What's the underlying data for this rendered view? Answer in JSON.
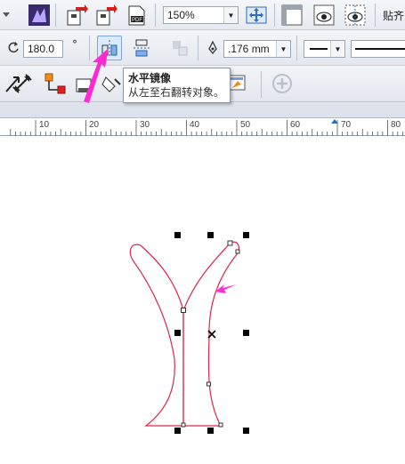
{
  "toolbar_top": {
    "zoom_value": "150%",
    "snap_label": "贴齐"
  },
  "property_bar": {
    "rotation_value": "180.0",
    "rotation_unit": "°",
    "outline_width_value": ".176 mm"
  },
  "tooltip": {
    "title": "水平镜像",
    "description": "从左至右翻转对象。"
  },
  "ruler": {
    "labels": [
      "10",
      "20",
      "30",
      "40",
      "50",
      "60",
      "70",
      "80"
    ]
  },
  "colors": {
    "shape_outline": "#e0264a",
    "annotation_arrow": "#ff2ad4",
    "selection_handle": "#000000"
  },
  "icons": [
    "dropdown-icon",
    "corel-logo-icon",
    "import-icon",
    "export-icon",
    "export-pdf-icon",
    "full-screen-preview-icon",
    "rulers-icon",
    "view-icon",
    "guidelines-icon",
    "mirror-horizontal-icon",
    "mirror-vertical-icon",
    "clear-transform-icon",
    "outline-pen-icon",
    "dimension-tool-icon",
    "smart-fill-icon",
    "fill-tool-icon",
    "eyedropper-icon",
    "add-icon"
  ]
}
